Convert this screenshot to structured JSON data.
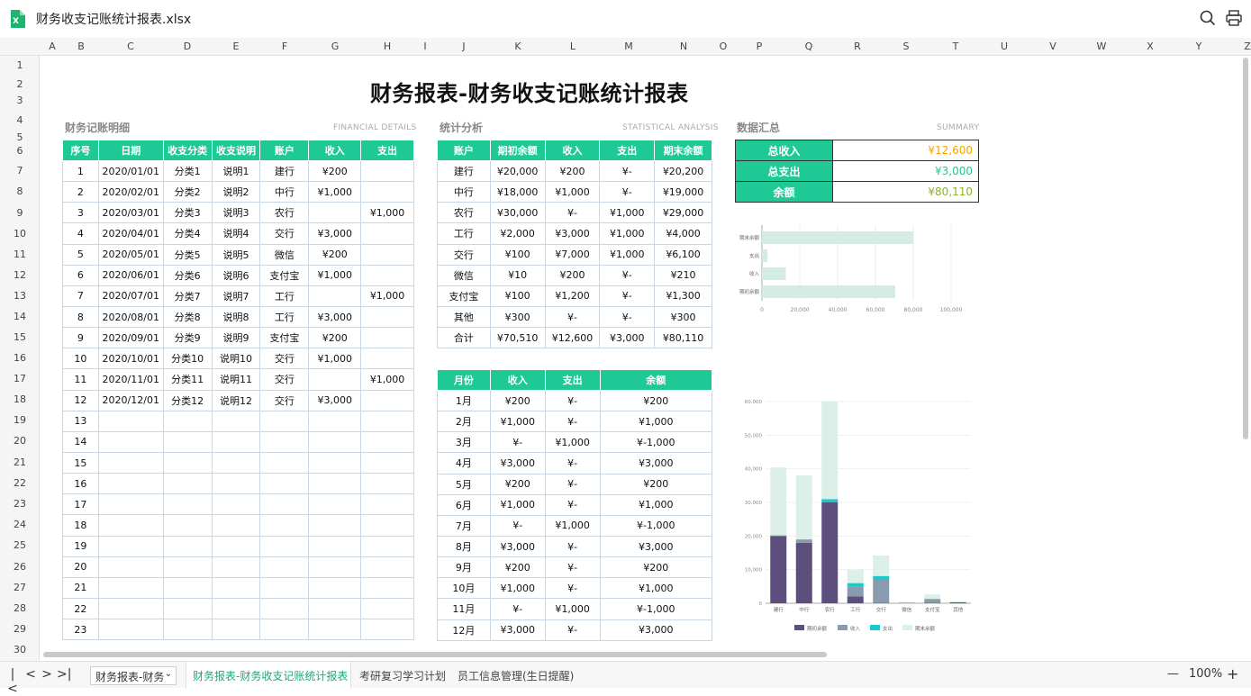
{
  "app": {
    "file_title": "财务收支记账统计报表.xlsx"
  },
  "columns": [
    "A",
    "B",
    "C",
    "D",
    "E",
    "F",
    "G",
    "H",
    "I",
    "J",
    "K",
    "L",
    "M",
    "N",
    "O",
    "P",
    "Q",
    "R",
    "S",
    "T",
    "U",
    "V",
    "W",
    "X",
    "Y",
    "Z"
  ],
  "rows": [
    "1",
    "2",
    "3",
    "4",
    "5",
    "6",
    "7",
    "8",
    "9",
    "10",
    "11",
    "12",
    "13",
    "14",
    "15",
    "16",
    "17",
    "18",
    "19",
    "20",
    "21",
    "22",
    "23",
    "24",
    "25",
    "26",
    "27",
    "28",
    "29",
    "30"
  ],
  "sheet": {
    "title": "财务报表-财务收支记账统计报表",
    "detail": {
      "label": "财务记账明细",
      "sub": "FINANCIAL  DETAILS",
      "headers": [
        "序号",
        "日期",
        "收支分类",
        "收支说明",
        "账户",
        "收入",
        "支出"
      ],
      "rows": [
        [
          "1",
          "2020/01/01",
          "分类1",
          "说明1",
          "建行",
          "¥200",
          ""
        ],
        [
          "2",
          "2020/02/01",
          "分类2",
          "说明2",
          "中行",
          "¥1,000",
          ""
        ],
        [
          "3",
          "2020/03/01",
          "分类3",
          "说明3",
          "农行",
          "",
          "¥1,000"
        ],
        [
          "4",
          "2020/04/01",
          "分类4",
          "说明4",
          "交行",
          "¥3,000",
          ""
        ],
        [
          "5",
          "2020/05/01",
          "分类5",
          "说明5",
          "微信",
          "¥200",
          ""
        ],
        [
          "6",
          "2020/06/01",
          "分类6",
          "说明6",
          "支付宝",
          "¥1,000",
          ""
        ],
        [
          "7",
          "2020/07/01",
          "分类7",
          "说明7",
          "工行",
          "",
          "¥1,000"
        ],
        [
          "8",
          "2020/08/01",
          "分类8",
          "说明8",
          "工行",
          "¥3,000",
          ""
        ],
        [
          "9",
          "2020/09/01",
          "分类9",
          "说明9",
          "支付宝",
          "¥200",
          ""
        ],
        [
          "10",
          "2020/10/01",
          "分类10",
          "说明10",
          "交行",
          "¥1,000",
          ""
        ],
        [
          "11",
          "2020/11/01",
          "分类11",
          "说明11",
          "交行",
          "",
          "¥1,000"
        ],
        [
          "12",
          "2020/12/01",
          "分类12",
          "说明12",
          "交行",
          "¥3,000",
          ""
        ],
        [
          "13",
          "",
          "",
          "",
          "",
          "",
          ""
        ],
        [
          "14",
          "",
          "",
          "",
          "",
          "",
          ""
        ],
        [
          "15",
          "",
          "",
          "",
          "",
          "",
          ""
        ],
        [
          "16",
          "",
          "",
          "",
          "",
          "",
          ""
        ],
        [
          "17",
          "",
          "",
          "",
          "",
          "",
          ""
        ],
        [
          "18",
          "",
          "",
          "",
          "",
          "",
          ""
        ],
        [
          "19",
          "",
          "",
          "",
          "",
          "",
          ""
        ],
        [
          "20",
          "",
          "",
          "",
          "",
          "",
          ""
        ],
        [
          "21",
          "",
          "",
          "",
          "",
          "",
          ""
        ],
        [
          "22",
          "",
          "",
          "",
          "",
          "",
          ""
        ],
        [
          "23",
          "",
          "",
          "",
          "",
          "",
          ""
        ]
      ]
    },
    "stats": {
      "label": "统计分析",
      "sub": "STATISTICAL  ANALYSIS",
      "headers": [
        "账户",
        "期初余额",
        "收入",
        "支出",
        "期末余额"
      ],
      "rows": [
        [
          "建行",
          "¥20,000",
          "¥200",
          "¥-",
          "¥20,200"
        ],
        [
          "中行",
          "¥18,000",
          "¥1,000",
          "¥-",
          "¥19,000"
        ],
        [
          "农行",
          "¥30,000",
          "¥-",
          "¥1,000",
          "¥29,000"
        ],
        [
          "工行",
          "¥2,000",
          "¥3,000",
          "¥1,000",
          "¥4,000"
        ],
        [
          "交行",
          "¥100",
          "¥7,000",
          "¥1,000",
          "¥6,100"
        ],
        [
          "微信",
          "¥10",
          "¥200",
          "¥-",
          "¥210"
        ],
        [
          "支付宝",
          "¥100",
          "¥1,200",
          "¥-",
          "¥1,300"
        ],
        [
          "其他",
          "¥300",
          "¥-",
          "¥-",
          "¥300"
        ],
        [
          "合计",
          "¥70,510",
          "¥12,600",
          "¥3,000",
          "¥80,110"
        ]
      ]
    },
    "monthly": {
      "headers": [
        "月份",
        "收入",
        "支出",
        "余额"
      ],
      "rows": [
        [
          "1月",
          "¥200",
          "¥-",
          "¥200"
        ],
        [
          "2月",
          "¥1,000",
          "¥-",
          "¥1,000"
        ],
        [
          "3月",
          "¥-",
          "¥1,000",
          "¥-1,000"
        ],
        [
          "4月",
          "¥3,000",
          "¥-",
          "¥3,000"
        ],
        [
          "5月",
          "¥200",
          "¥-",
          "¥200"
        ],
        [
          "6月",
          "¥1,000",
          "¥-",
          "¥1,000"
        ],
        [
          "7月",
          "¥-",
          "¥1,000",
          "¥-1,000"
        ],
        [
          "8月",
          "¥3,000",
          "¥-",
          "¥3,000"
        ],
        [
          "9月",
          "¥200",
          "¥-",
          "¥200"
        ],
        [
          "10月",
          "¥1,000",
          "¥-",
          "¥1,000"
        ],
        [
          "11月",
          "¥-",
          "¥1,000",
          "¥-1,000"
        ],
        [
          "12月",
          "¥3,000",
          "¥-",
          "¥3,000"
        ]
      ]
    },
    "summary": {
      "label": "数据汇总",
      "sub": "SUMMARY",
      "items": [
        {
          "label": "总收入",
          "value": "¥12,600",
          "color": "#f0a500"
        },
        {
          "label": "总支出",
          "value": "¥3,000",
          "color": "#1fc995"
        },
        {
          "label": "余额",
          "value": "¥80,110",
          "color": "#8bb32c"
        }
      ]
    }
  },
  "chart_data": [
    {
      "type": "bar",
      "orientation": "horizontal",
      "categories": [
        "期末余额",
        "支出",
        "收入",
        "期初余额"
      ],
      "values": [
        80110,
        3000,
        12600,
        70510
      ],
      "xticks": [
        "0",
        "20,000",
        "40,000",
        "60,000",
        "80,000",
        "100,000"
      ],
      "xlim": [
        0,
        100000
      ],
      "colors": {
        "bar": "#d4ece4"
      }
    },
    {
      "type": "bar",
      "stacked": true,
      "categories": [
        "建行",
        "中行",
        "农行",
        "工行",
        "交行",
        "微信",
        "支付宝",
        "其他"
      ],
      "series": [
        {
          "name": "期初余额",
          "values": [
            20000,
            18000,
            30000,
            2000,
            100,
            10,
            100,
            300
          ],
          "color": "#5c4f7d"
        },
        {
          "name": "收入",
          "values": [
            200,
            1000,
            0,
            3000,
            7000,
            200,
            1200,
            0
          ],
          "color": "#8a9bb0"
        },
        {
          "name": "支出",
          "values": [
            0,
            0,
            1000,
            1000,
            1000,
            0,
            0,
            0
          ],
          "color": "#1ec8c8"
        },
        {
          "name": "期末余额",
          "values": [
            20200,
            19000,
            29000,
            4000,
            6100,
            210,
            1300,
            300
          ],
          "color": "#dcefe8"
        }
      ],
      "yticks": [
        "0",
        "10,000",
        "20,000",
        "30,000",
        "40,000",
        "50,000",
        "60,000"
      ],
      "ylim": [
        0,
        60000
      ]
    }
  ],
  "bottom": {
    "sheet_select": "财务报表-财务",
    "tabs": [
      "财务报表-财务收支记账统计报表",
      "考研复习学习计划",
      "员工信息管理(生日提醒)"
    ],
    "zoom": "100%",
    "zoom_minus": "—",
    "zoom_plus": "+"
  }
}
